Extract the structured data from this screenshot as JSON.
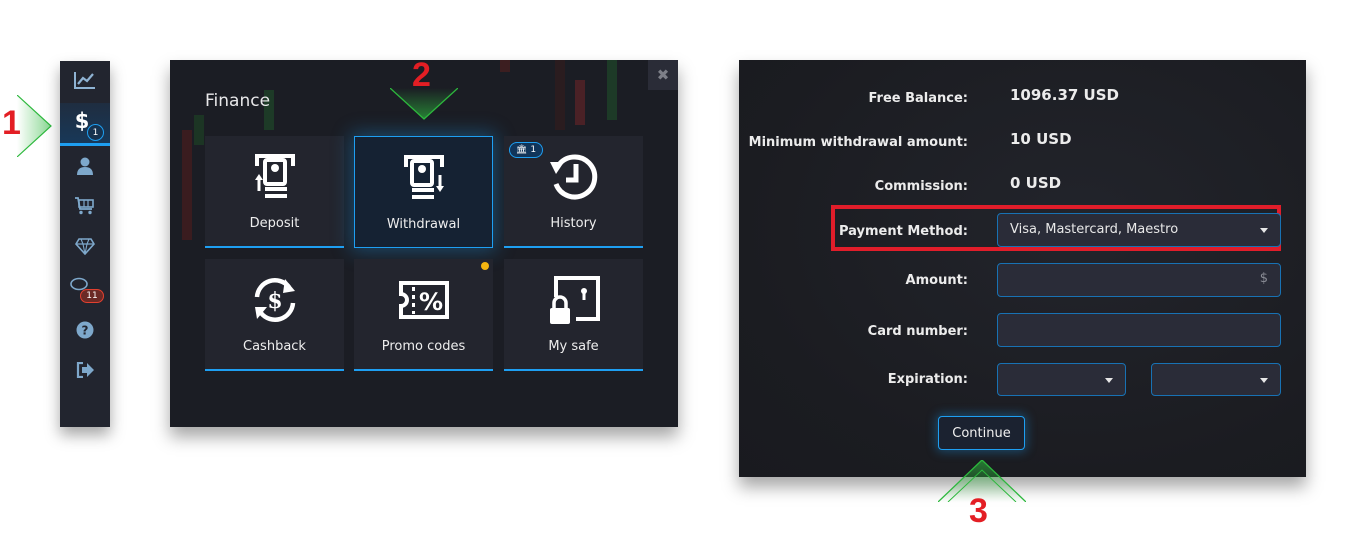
{
  "annotations": {
    "step1": "1",
    "step2": "2",
    "step3": "3"
  },
  "sidebar": {
    "items": [
      {
        "icon": "chart-icon",
        "label": "Trading"
      },
      {
        "icon": "dollar-icon",
        "label": "Finance",
        "active": true,
        "badge": "1"
      },
      {
        "icon": "user-icon",
        "label": "Profile"
      },
      {
        "icon": "cart-icon",
        "label": "Market"
      },
      {
        "icon": "diamond-icon",
        "label": "Achievements"
      },
      {
        "icon": "chat-icon",
        "label": "Chat",
        "badge": "11"
      },
      {
        "icon": "help-icon",
        "label": "Help"
      },
      {
        "icon": "logout-icon",
        "label": "Logout"
      }
    ]
  },
  "finance": {
    "title": "Finance",
    "close_label": "✖",
    "tiles": [
      {
        "label": "Deposit",
        "icon": "deposit-icon"
      },
      {
        "label": "Withdrawal",
        "icon": "withdrawal-icon",
        "selected": true
      },
      {
        "label": "History",
        "icon": "history-icon",
        "badge": "1"
      },
      {
        "label": "Cashback",
        "icon": "cashback-icon"
      },
      {
        "label": "Promo codes",
        "icon": "promo-icon",
        "notification": true
      },
      {
        "label": "My safe",
        "icon": "safe-icon"
      }
    ]
  },
  "withdrawal": {
    "free_balance_label": "Free Balance:",
    "free_balance_value": "1096.37 USD",
    "min_label": "Minimum withdrawal amount:",
    "min_value": "10 USD",
    "commission_label": "Commission:",
    "commission_value": "0 USD",
    "payment_method_label": "Payment Method:",
    "payment_method_value": "Visa, Mastercard, Maestro",
    "amount_label": "Amount:",
    "amount_value": "",
    "amount_currency": "$",
    "card_label": "Card number:",
    "card_value": "",
    "expiration_label": "Expiration:",
    "exp_month": "",
    "exp_year": "",
    "continue_label": "Continue"
  },
  "colors": {
    "accent": "#1e9ff2",
    "highlight": "#e11d2a",
    "arrow": "#2db83d",
    "notify": "#f5b510"
  }
}
